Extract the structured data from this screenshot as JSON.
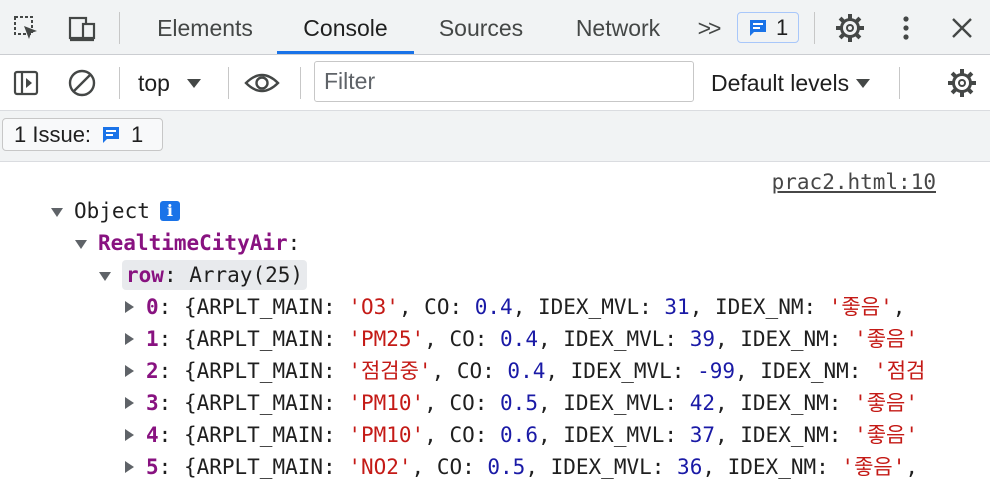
{
  "tabs": [
    {
      "label": "Elements"
    },
    {
      "label": "Console"
    },
    {
      "label": "Sources"
    },
    {
      "label": "Network"
    }
  ],
  "more_tabs_label": ">>",
  "issue_badge_count": "1",
  "context_selector": {
    "value": "top"
  },
  "filter": {
    "placeholder": "Filter",
    "value": ""
  },
  "levels": {
    "label": "Default levels"
  },
  "issues_bar": {
    "label": "1 Issue:",
    "count": "1"
  },
  "console": {
    "source_link": "prac2.html:10",
    "object_label": "Object",
    "info_icon": "i",
    "realtime_key": "RealtimeCityAir",
    "row_key": "row",
    "row_value": "Array(25)",
    "rows": [
      {
        "index": "0",
        "main": "'O3'",
        "co": "0.4",
        "mvl": "31",
        "nm": "'좋음'",
        "tail": ","
      },
      {
        "index": "1",
        "main": "'PM25'",
        "co": "0.4",
        "mvl": "39",
        "nm": "'좋음'",
        "tail": ""
      },
      {
        "index": "2",
        "main": "'점검중'",
        "co": "0.4",
        "mvl": "-99",
        "nm": "'점검",
        "tail": ""
      },
      {
        "index": "3",
        "main": "'PM10'",
        "co": "0.5",
        "mvl": "42",
        "nm": "'좋음'",
        "tail": ""
      },
      {
        "index": "4",
        "main": "'PM10'",
        "co": "0.6",
        "mvl": "37",
        "nm": "'좋음'",
        "tail": ""
      },
      {
        "index": "5",
        "main": "'NO2'",
        "co": "0.5",
        "mvl": "36",
        "nm": "'좋음'",
        "tail": ","
      }
    ]
  },
  "colors": {
    "accent": "#1a73e8",
    "key": "#881280",
    "number": "#1a1aa6",
    "string": "#c41a16"
  }
}
